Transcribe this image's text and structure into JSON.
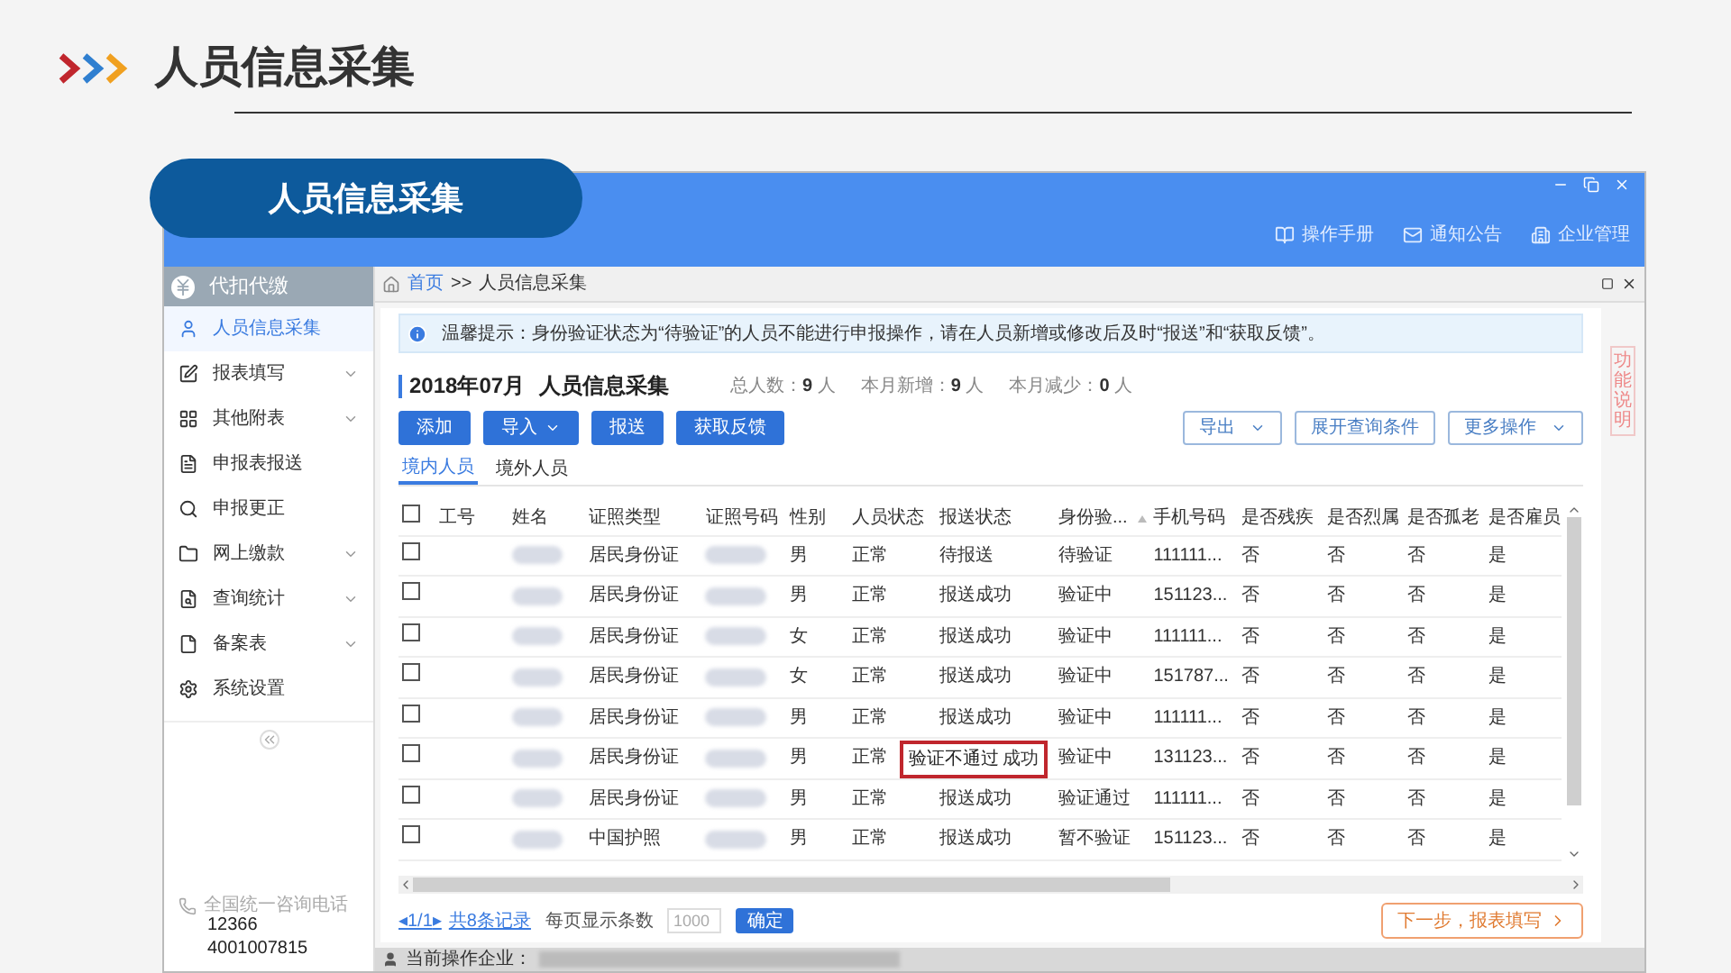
{
  "slide": {
    "title": "人员信息采集",
    "badge": "人员信息采集"
  },
  "window": {
    "top_menu": [
      "操作手册",
      "通知公告",
      "企业管理"
    ]
  },
  "sidebar": {
    "title": "代扣代缴",
    "items": [
      {
        "label": "人员信息采集",
        "selected": true,
        "has_submenu": false
      },
      {
        "label": "报表填写",
        "selected": false,
        "has_submenu": true
      },
      {
        "label": "其他附表",
        "selected": false,
        "has_submenu": true
      },
      {
        "label": "申报表报送",
        "selected": false,
        "has_submenu": false
      },
      {
        "label": "申报更正",
        "selected": false,
        "has_submenu": false
      },
      {
        "label": "网上缴款",
        "selected": false,
        "has_submenu": true
      },
      {
        "label": "查询统计",
        "selected": false,
        "has_submenu": true
      },
      {
        "label": "备案表",
        "selected": false,
        "has_submenu": true
      },
      {
        "label": "系统设置",
        "selected": false,
        "has_submenu": false
      }
    ],
    "hotline": {
      "label": "全国统一咨询电话",
      "numbers": [
        "12366",
        "4001007815"
      ]
    }
  },
  "breadcrumb": [
    "首页",
    ">>",
    "人员信息采集"
  ],
  "notice": "温馨提示：身份验证状态为“待验证”的人员不能进行申报操作，请在人员新增或修改后及时“报送”和“获取反馈”。",
  "heading": {
    "period": "2018年07月",
    "title": "人员信息采集",
    "stats": [
      {
        "label": "总人数：",
        "value": "9",
        "unit": "人"
      },
      {
        "label": "本月新增：",
        "value": "9",
        "unit": "人"
      },
      {
        "label": "本月减少：",
        "value": "0",
        "unit": "人"
      }
    ]
  },
  "actions": [
    {
      "label": "添加",
      "dropdown": false
    },
    {
      "label": "导入",
      "dropdown": true
    },
    {
      "label": "报送",
      "dropdown": false
    },
    {
      "label": "获取反馈",
      "dropdown": false
    }
  ],
  "right_actions": [
    {
      "label": "导出",
      "dropdown": true
    },
    {
      "label": "展开查询条件",
      "dropdown": false
    },
    {
      "label": "更多操作",
      "dropdown": true
    }
  ],
  "tabs": [
    {
      "label": "境内人员",
      "selected": true
    },
    {
      "label": "境外人员",
      "selected": false
    }
  ],
  "side_tab": "功能说明",
  "table": {
    "header_checked": false,
    "columns": [
      "工号",
      "姓名",
      "证照类型",
      "证照号码",
      "性别",
      "人员状态",
      "报送状态",
      "身份验...",
      "手机号码",
      "是否残疾",
      "是否烈属",
      "是否孤老",
      "是否雇员"
    ],
    "rows": [
      {
        "checked": false,
        "id_type": "居民身份证",
        "gender": "男",
        "person_status": "正常",
        "send_status": "待报送",
        "verify": "待验证",
        "phone": "111111...",
        "disabled": "否",
        "martyr": "否",
        "elderly": "否",
        "employee": "是"
      },
      {
        "checked": false,
        "id_type": "居民身份证",
        "gender": "男",
        "person_status": "正常",
        "send_status": "报送成功",
        "verify": "验证中",
        "phone": "151123...",
        "disabled": "否",
        "martyr": "否",
        "elderly": "否",
        "employee": "是"
      },
      {
        "checked": false,
        "id_type": "居民身份证",
        "gender": "女",
        "person_status": "正常",
        "send_status": "报送成功",
        "verify": "验证中",
        "phone": "111111...",
        "disabled": "否",
        "martyr": "否",
        "elderly": "否",
        "employee": "是"
      },
      {
        "checked": false,
        "id_type": "居民身份证",
        "gender": "女",
        "person_status": "正常",
        "send_status": "报送成功",
        "verify": "验证中",
        "phone": "151787...",
        "disabled": "否",
        "martyr": "否",
        "elderly": "否",
        "employee": "是"
      },
      {
        "checked": false,
        "id_type": "居民身份证",
        "gender": "男",
        "person_status": "正常",
        "send_status": "报送成功",
        "verify": "验证中",
        "phone": "111111...",
        "disabled": "否",
        "martyr": "否",
        "elderly": "否",
        "employee": "是"
      },
      {
        "checked": false,
        "id_type": "居民身份证",
        "gender": "男",
        "person_status": "正常",
        "send_status": "成功",
        "callout": "验证不通过",
        "verify": "验证中",
        "phone": "131123...",
        "disabled": "否",
        "martyr": "否",
        "elderly": "否",
        "employee": "是"
      },
      {
        "checked": false,
        "id_type": "居民身份证",
        "gender": "男",
        "person_status": "正常",
        "send_status": "报送成功",
        "verify": "验证通过",
        "phone": "111111...",
        "disabled": "否",
        "martyr": "否",
        "elderly": "否",
        "employee": "是"
      },
      {
        "checked": false,
        "id_type": "中国护照",
        "gender": "男",
        "person_status": "正常",
        "send_status": "报送成功",
        "verify": "暂不验证",
        "phone": "151123...",
        "disabled": "否",
        "martyr": "否",
        "elderly": "否",
        "employee": "是"
      }
    ]
  },
  "pagination": {
    "prev": "◂",
    "pages": "1/1",
    "next": "▸",
    "total": "共8条记录",
    "per_page_label": "每页显示条数",
    "per_page": "1000",
    "confirm": "确定"
  },
  "next_button": "下一步，报表填写",
  "status_bar": {
    "label": "当前操作企业："
  }
}
